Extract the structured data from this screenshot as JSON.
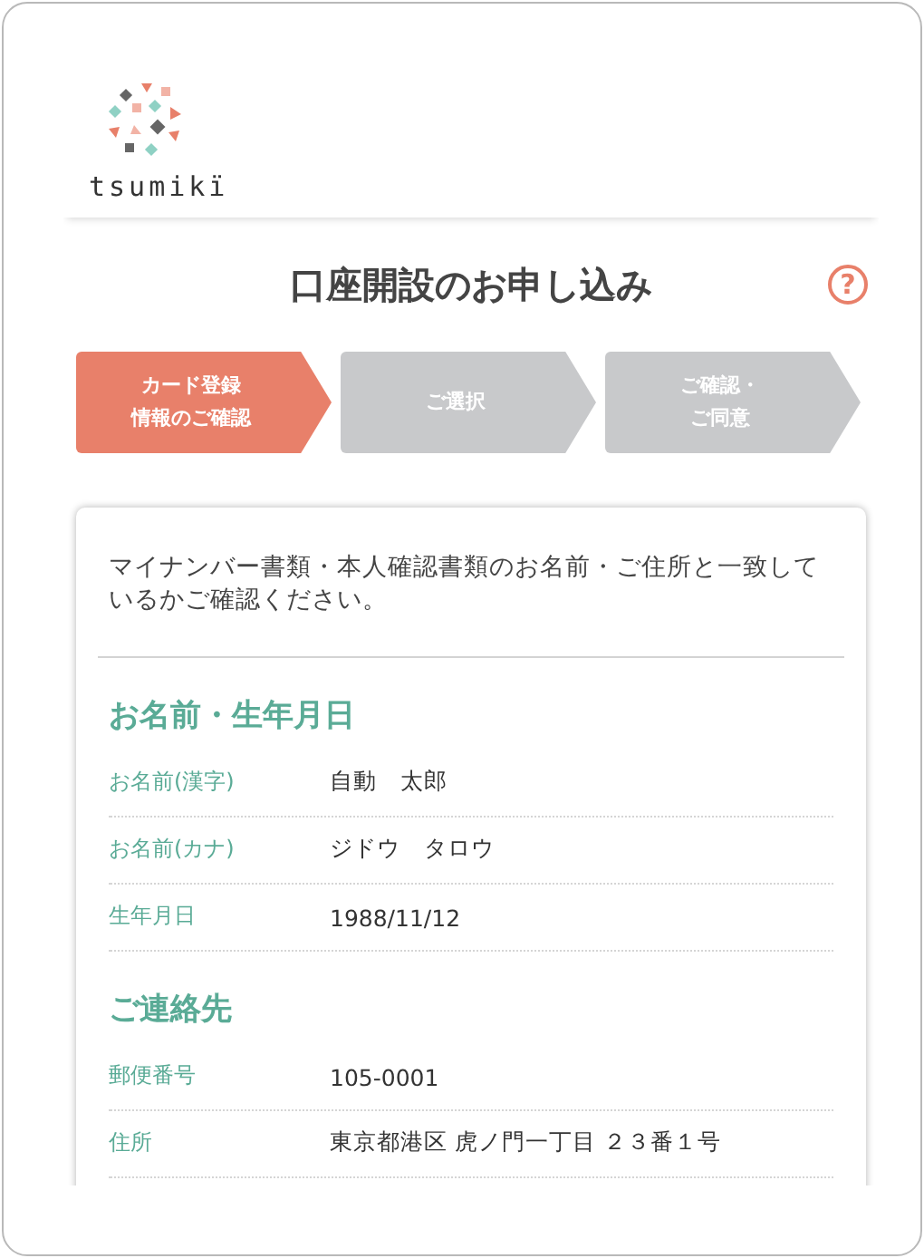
{
  "header": {
    "logo_text": "tsumikï"
  },
  "title": "口座開設のお申し込み",
  "help": "?",
  "steps": [
    {
      "lines": [
        "カード登録",
        "情報のご確認"
      ],
      "selected": true
    },
    {
      "lines": [
        "ご選択"
      ],
      "selected": false
    },
    {
      "lines": [
        "ご確認・",
        "ご同意"
      ],
      "selected": false
    }
  ],
  "intro": "マイナンバー書類・本人確認書類のお名前・ご住所と一致しているかご確認ください。",
  "sections": [
    {
      "title": "お名前・生年月日",
      "rows": [
        {
          "label": "お名前(漢字)",
          "value": "自動　太郎"
        },
        {
          "label": "お名前(カナ)",
          "value": "ジドウ　タロウ"
        },
        {
          "label": "生年月日",
          "value": "1988/11/12"
        }
      ]
    },
    {
      "title": "ご連絡先",
      "rows": [
        {
          "label": "郵便番号",
          "value": "105-0001"
        },
        {
          "label": "住所",
          "value": "東京都港区 虎ノ門一丁目 ２３番１号"
        }
      ]
    }
  ]
}
